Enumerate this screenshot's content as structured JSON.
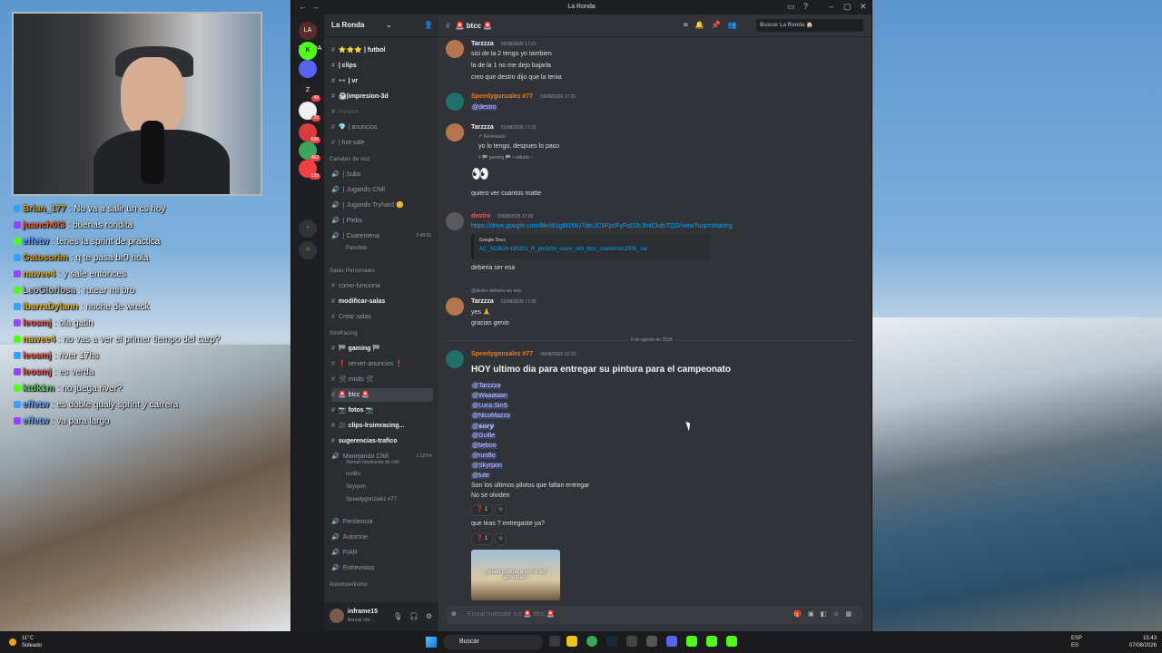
{
  "window": {
    "title": "La Ronda"
  },
  "chat_overlay": [
    {
      "user": "Brian_177",
      "color": "#d4a017",
      "text": ": No va a salir un cs hoy"
    },
    {
      "user": "juanch0t3",
      "color": "#e8632b",
      "text": ": buenas rondita"
    },
    {
      "user": "effetw",
      "color": "#6aa3ff",
      "text": ": tenes la sprint de práctica"
    },
    {
      "user": "Gatosorim",
      "color": "#d4a017",
      "text": ": q te pasa br0 hola"
    },
    {
      "user": "nawee4",
      "color": "#e8b923",
      "text": ": y sale entonces"
    },
    {
      "user": "LeoGlorlosa",
      "color": "#bfbfbf",
      "text": ": rutear mi bro"
    },
    {
      "user": "IbarraDylann",
      "color": "#e8b923",
      "text": ": noche de wreck"
    },
    {
      "user": "leosmj",
      "color": "#e35d5d",
      "text": ": ola gatin"
    },
    {
      "user": "nawee4",
      "color": "#e8b923",
      "text": ": no vas a ver el primer tiempo del carp?"
    },
    {
      "user": "leosmj",
      "color": "#e35d5d",
      "text": ": river 17hs"
    },
    {
      "user": "leosmj",
      "color": "#e35d5d",
      "text": ": es verda"
    },
    {
      "user": "ktdk1m",
      "color": "#5ec46b",
      "text": ": no juega river?"
    },
    {
      "user": "effetw",
      "color": "#6aa3ff",
      "text": ": es doble qualy sprint y carrera"
    },
    {
      "user": "effetw",
      "color": "#6aa3ff",
      "text": ": va para largo"
    }
  ],
  "servers": [
    {
      "label": "LA RONDA",
      "count": ""
    },
    {
      "label": "K",
      "count": ""
    },
    {
      "label": "",
      "count": ""
    },
    {
      "label": "Z",
      "count": "49"
    },
    {
      "label": "",
      "count": "20"
    },
    {
      "label": "",
      "count": "636"
    },
    {
      "label": "",
      "count": "463"
    },
    {
      "label": "",
      "count": "139"
    }
  ],
  "sidebar": {
    "guild": "La Ronda",
    "channels_top": [
      {
        "label": "⭐⭐⭐ | futbol",
        "style": "bold"
      },
      {
        "label": "| clips",
        "style": "bold"
      },
      {
        "label": "👓 | vr",
        "style": "bold"
      },
      {
        "label": "🖨|impresion-3d",
        "style": "bold"
      },
      {
        "label": "musica",
        "style": "dim"
      },
      {
        "label": "💎 | anuncios",
        "style": ""
      },
      {
        "label": "| hot-sale",
        "style": ""
      }
    ],
    "voice_category": "Canales de voz",
    "voice": [
      {
        "label": "| Subs"
      },
      {
        "label": "| Jugando Chill"
      },
      {
        "label": "| Jugando Tryhard 😊"
      },
      {
        "label": "| Plebs"
      },
      {
        "label": "| Cuarentena",
        "time": "2:49:50"
      }
    ],
    "voice_user": "Panchito",
    "personal_category": "Salas Personales",
    "personal": [
      {
        "label": "como-funciona",
        "style": ""
      },
      {
        "label": "modificar-salas",
        "style": "bold"
      },
      {
        "label": "Crear salas",
        "style": ""
      }
    ],
    "simracing_category": "SimRacing",
    "simracing": [
      {
        "label": "🏁 gaming 🏁",
        "style": "bold"
      },
      {
        "label": "❗ server-anuncios ❗",
        "style": ""
      },
      {
        "label": "🛠 mods 🛠",
        "style": ""
      },
      {
        "label": "🚨 btcc 🚨",
        "style": "active"
      },
      {
        "label": "📷 fotos 📷",
        "style": "bold"
      },
      {
        "label": "🎥 clips-lrsimracing...",
        "style": "bold"
      },
      {
        "label": "sugerencias-trafico",
        "style": "bold"
      }
    ],
    "chill": {
      "label": "Manejando Chill",
      "status": "Viernes totalmente de chill",
      "time": "1:12:54"
    },
    "chill_users": [
      "runBo",
      "Skyrpon",
      "Speedygonzalez #77"
    ],
    "bottom": [
      "Penitencia",
      "Autocine",
      "FIAR",
      "Entrevistas"
    ],
    "auto_category": "Automovilismo",
    "user": {
      "name": "inframe15",
      "status": "Bersuit Ver..."
    }
  },
  "header": {
    "channel": "🚨 btcc 🚨",
    "search_placeholder": "Buscar La Ronda 🏠"
  },
  "messages": {
    "m1": {
      "author": "Tarzzza",
      "time": "03/08/2026 17:21",
      "lines": [
        "sisi de la 2 tengo yo tambien",
        "la de la 1 no me dejo bajarla",
        "creo que destro dijo que la tenia"
      ]
    },
    "m2": {
      "author": "Speedygonzalez #77",
      "time": "03/08/2026 17:22",
      "mention": "@destro"
    },
    "m3": {
      "author": "Tarzzza",
      "time": "03/08/2026 17:22",
      "forward": "↱ Reenviado",
      "fwd_text": "yo lo tengo, despues lo paso",
      "fwd_meta": "# 🏁 gaming 🏁 • sábado ›",
      "emoji": "👀",
      "after": "quiero ver cuantos matte"
    },
    "m4": {
      "author": "destro",
      "time": "03/08/2026 17:25",
      "link": "https://drive.google.com/file/d/1gM2MU7dtnJC8FpcFyFoD3cJh4CkdsTQD/view?usp=sharing",
      "embed_src": "Google Docs",
      "embed_title": "AC_010826-185322_R_pm3dm_volvo_s40_btcc_snetterton2005_.rar",
      "after": "deberia ser esa"
    },
    "m5": {
      "author": "Tarzzza",
      "time": "03/08/2026 17:35",
      "reply": "@destro deberia ser esa",
      "lines": [
        "yes 🙏",
        "gracias genio"
      ]
    },
    "date_divider": "6 de agosto de 2026",
    "m6": {
      "author": "Speedygonzalez #77",
      "time": "06/08/2026 12:19",
      "headline": "HOY ultimo dia para entregar su pintura para el campeonato",
      "mentions": [
        "@Tarzzza",
        "@Waaataan",
        "@Luca.SinS",
        "@NicoMazza",
        "@𝙨𝙤𝙧𝙮",
        "@Guille",
        "@beboo",
        "@runBo",
        "@Skyrpon",
        "@tute"
      ],
      "line1": "Son los ultimos pilotos que faltan entregar",
      "line2": "No se olviden",
      "react1": "❓ 1",
      "question": "que tiras ? entregaste ya?",
      "react2": "❓ 1",
      "image_caption": "¿eeeo compa a ver si asi aprendes?"
    }
  },
  "composer": {
    "placeholder": "Enviar mensaje a # 🚨 btcc 🚨"
  },
  "taskbar": {
    "weather_temp": "11°C",
    "weather_desc": "Soleado",
    "search": "Buscar",
    "lang1": "ESP",
    "lang2": "ES",
    "time": "15:43",
    "date": "07/08/2026"
  },
  "colors": {
    "speedy": "#e67e22",
    "destro": "#e35d5d",
    "tarzzza": "#f2f3f5",
    "mention_bg": "#3c4270"
  }
}
